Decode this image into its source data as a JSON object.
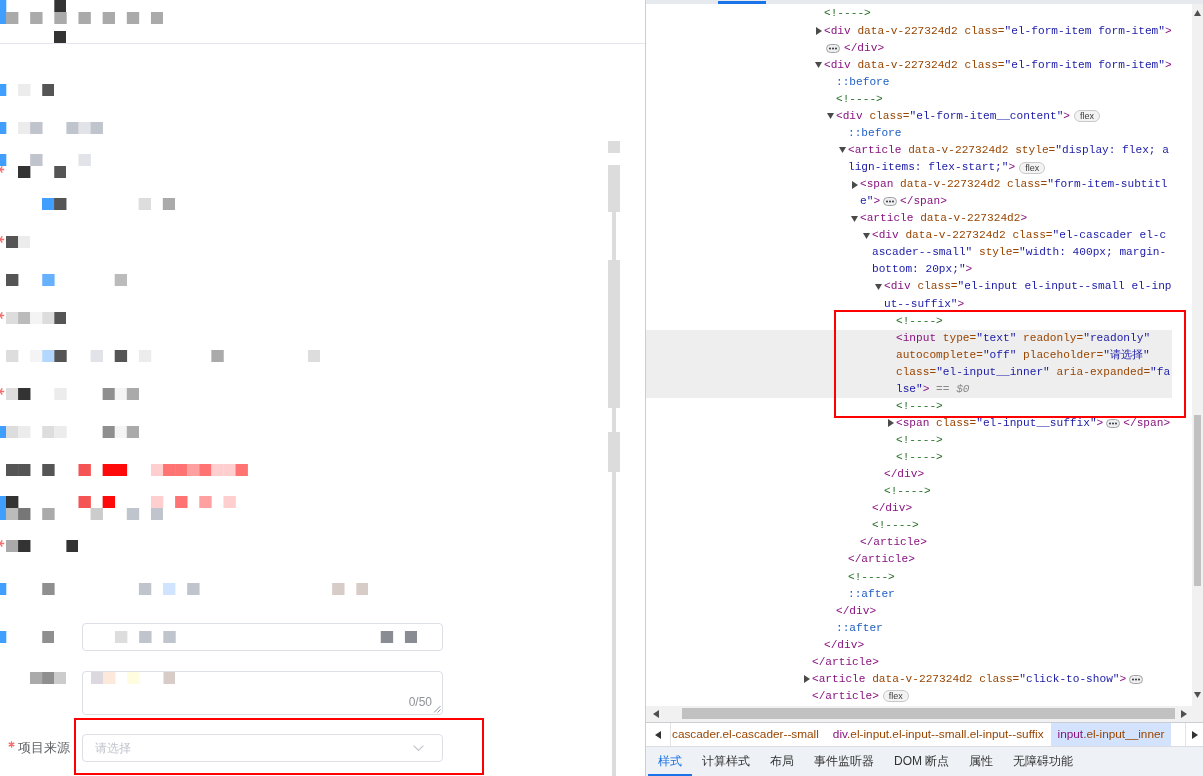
{
  "page": {
    "masked_rows": [
      {
        "kind": "text",
        "required": false
      },
      {
        "kind": "text",
        "required": false
      },
      {
        "kind": "text",
        "required": true
      },
      {
        "kind": "text",
        "required": false
      },
      {
        "kind": "text",
        "required": true
      },
      {
        "kind": "text",
        "required": false
      },
      {
        "kind": "text",
        "required": true
      },
      {
        "kind": "text",
        "required": false
      },
      {
        "kind": "text",
        "required": true
      },
      {
        "kind": "text",
        "required": false
      },
      {
        "kind": "text",
        "required": false
      },
      {
        "kind": "text",
        "required": false
      },
      {
        "kind": "text",
        "required": true
      },
      {
        "kind": "text",
        "required": false
      },
      {
        "kind": "input",
        "required": false
      },
      {
        "kind": "textarea",
        "required": false,
        "counter": "0/50"
      }
    ],
    "select_field": {
      "label": "项目来源",
      "required": true,
      "placeholder": "请选择",
      "boxed": true
    }
  },
  "devtools": {
    "elements_tree": [
      {
        "selected": false,
        "children": [
          {
            "selected": false,
            "lines": [
              [
                {
                  "kind": "comment",
                  "text": "<!---->"
                }
              ]
            ]
          },
          {
            "expanded": false,
            "selected": false,
            "lines": [
              [
                {
                  "kind": "tag",
                  "text": "<div"
                },
                {
                  "kind": "attr",
                  "text": " data-v-227324d2"
                },
                {
                  "kind": "attr",
                  "text": " class="
                },
                {
                  "kind": "value",
                  "text": "\"el-form-item form-item\""
                },
                {
                  "kind": "tag",
                  "text": ">"
                }
              ],
              [
                {
                  "kind": "ellipsis"
                },
                {
                  "kind": "tag",
                  "text": "</div>"
                }
              ]
            ]
          },
          {
            "expanded": true,
            "selected": false,
            "lines": [
              [
                {
                  "kind": "tag",
                  "text": "<div"
                },
                {
                  "kind": "attr",
                  "text": " data-v-227324d2"
                },
                {
                  "kind": "attr",
                  "text": " class="
                },
                {
                  "kind": "value",
                  "text": "\"el-form-item form-item\""
                },
                {
                  "kind": "tag",
                  "text": ">"
                }
              ]
            ],
            "children": [
              {
                "selected": false,
                "lines": [
                  [
                    {
                      "kind": "pseudo",
                      "text": "::before"
                    }
                  ]
                ]
              },
              {
                "selected": false,
                "lines": [
                  [
                    {
                      "kind": "comment",
                      "text": "<!---->"
                    }
                  ]
                ]
              },
              {
                "expanded": true,
                "selected": false,
                "lines": [
                  [
                    {
                      "kind": "tag",
                      "text": "<div"
                    },
                    {
                      "kind": "attr",
                      "text": " class="
                    },
                    {
                      "kind": "value",
                      "text": "\"el-form-item__content\""
                    },
                    {
                      "kind": "tag",
                      "text": ">"
                    },
                    {
                      "kind": "badge",
                      "text": "flex"
                    }
                  ]
                ],
                "children": [
                  {
                    "selected": false,
                    "lines": [
                      [
                        {
                          "kind": "pseudo",
                          "text": "::before"
                        }
                      ]
                    ]
                  },
                  {
                    "expanded": true,
                    "selected": false,
                    "lines": [
                      [
                        {
                          "kind": "tag",
                          "text": "<article"
                        },
                        {
                          "kind": "attr",
                          "text": " data-v-227324d2"
                        },
                        {
                          "kind": "attr",
                          "text": " style="
                        },
                        {
                          "kind": "value",
                          "text": "\"display: flex; a"
                        }
                      ],
                      [
                        {
                          "kind": "value",
                          "text": "lign-items: flex-start;\""
                        },
                        {
                          "kind": "tag",
                          "text": ">"
                        },
                        {
                          "kind": "badge",
                          "text": "flex"
                        }
                      ]
                    ],
                    "children": [
                      {
                        "expanded": false,
                        "selected": false,
                        "lines": [
                          [
                            {
                              "kind": "tag",
                              "text": "<span"
                            },
                            {
                              "kind": "attr",
                              "text": " data-v-227324d2"
                            },
                            {
                              "kind": "attr",
                              "text": " class="
                            },
                            {
                              "kind": "value",
                              "text": "\"form-item-subtitl"
                            }
                          ],
                          [
                            {
                              "kind": "value",
                              "text": "e\""
                            },
                            {
                              "kind": "tag",
                              "text": ">"
                            },
                            {
                              "kind": "ellipsis"
                            },
                            {
                              "kind": "tag",
                              "text": "</span>"
                            }
                          ]
                        ]
                      },
                      {
                        "expanded": true,
                        "selected": false,
                        "lines": [
                          [
                            {
                              "kind": "tag",
                              "text": "<article"
                            },
                            {
                              "kind": "attr",
                              "text": " data-v-227324d2"
                            },
                            {
                              "kind": "tag",
                              "text": ">"
                            }
                          ]
                        ],
                        "children": [
                          {
                            "expanded": true,
                            "selected": false,
                            "lines": [
                              [
                                {
                                  "kind": "tag",
                                  "text": "<div"
                                },
                                {
                                  "kind": "attr",
                                  "text": " data-v-227324d2"
                                },
                                {
                                  "kind": "attr",
                                  "text": " class="
                                },
                                {
                                  "kind": "value",
                                  "text": "\"el-cascader el-c"
                                }
                              ],
                              [
                                {
                                  "kind": "value",
                                  "text": "ascader--small\""
                                },
                                {
                                  "kind": "attr",
                                  "text": " style="
                                },
                                {
                                  "kind": "value",
                                  "text": "\"width: 400px; margin-"
                                }
                              ],
                              [
                                {
                                  "kind": "value",
                                  "text": "bottom: 20px;\""
                                },
                                {
                                  "kind": "tag",
                                  "text": ">"
                                }
                              ]
                            ],
                            "children": [
                              {
                                "expanded": true,
                                "selected": false,
                                "lines": [
                                  [
                                    {
                                      "kind": "tag",
                                      "text": "<div"
                                    },
                                    {
                                      "kind": "attr",
                                      "text": " class="
                                    },
                                    {
                                      "kind": "value",
                                      "text": "\"el-input el-input--small el-inp"
                                    }
                                  ],
                                  [
                                    {
                                      "kind": "value",
                                      "text": "ut--suffix\""
                                    },
                                    {
                                      "kind": "tag",
                                      "text": ">"
                                    }
                                  ]
                                ],
                                "children": [
                                  {
                                    "selected": false,
                                    "boxed": true,
                                    "lines": [
                                      [
                                        {
                                          "kind": "comment",
                                          "text": "<!---->"
                                        }
                                      ]
                                    ]
                                  },
                                  {
                                    "selected": true,
                                    "boxed": true,
                                    "lines": [
                                      [
                                        {
                                          "kind": "tag",
                                          "text": "<input"
                                        },
                                        {
                                          "kind": "attr",
                                          "text": " type="
                                        },
                                        {
                                          "kind": "value",
                                          "text": "\"text\""
                                        },
                                        {
                                          "kind": "attr",
                                          "text": " readonly="
                                        },
                                        {
                                          "kind": "value",
                                          "text": "\"readonly\""
                                        }
                                      ],
                                      [
                                        {
                                          "kind": "attr",
                                          "text": "autocomplete="
                                        },
                                        {
                                          "kind": "value",
                                          "text": "\"off\""
                                        },
                                        {
                                          "kind": "attr",
                                          "text": " placeholder="
                                        },
                                        {
                                          "kind": "value",
                                          "text": "\"请选择\""
                                        }
                                      ],
                                      [
                                        {
                                          "kind": "attr",
                                          "text": "class="
                                        },
                                        {
                                          "kind": "value",
                                          "text": "\"el-input__inner\""
                                        },
                                        {
                                          "kind": "attr",
                                          "text": " aria-expanded="
                                        },
                                        {
                                          "kind": "value",
                                          "text": "\"fa"
                                        }
                                      ],
                                      [
                                        {
                                          "kind": "value",
                                          "text": "lse\""
                                        },
                                        {
                                          "kind": "tag",
                                          "text": ">"
                                        },
                                        {
                                          "kind": "note",
                                          "text": " == $0"
                                        }
                                      ]
                                    ]
                                  },
                                  {
                                    "selected": false,
                                    "boxed": true,
                                    "lines": [
                                      [
                                        {
                                          "kind": "comment",
                                          "text": "<!---->"
                                        }
                                      ]
                                    ]
                                  },
                                  {
                                    "expanded": false,
                                    "selected": false,
                                    "boxed": false,
                                    "lines": [
                                      [
                                        {
                                          "kind": "tag",
                                          "text": "<span"
                                        },
                                        {
                                          "kind": "attr",
                                          "text": " class="
                                        },
                                        {
                                          "kind": "value",
                                          "text": "\"el-input__suffix\""
                                        },
                                        {
                                          "kind": "tag",
                                          "text": ">"
                                        },
                                        {
                                          "kind": "ellipsis"
                                        },
                                        {
                                          "kind": "tag",
                                          "text": "</span>"
                                        }
                                      ]
                                    ]
                                  },
                                  {
                                    "selected": false,
                                    "boxed": false,
                                    "lines": [
                                      [
                                        {
                                          "kind": "comment",
                                          "text": "<!---->"
                                        }
                                      ]
                                    ]
                                  },
                                  {
                                    "selected": false,
                                    "boxed": false,
                                    "lines": [
                                      [
                                        {
                                          "kind": "comment",
                                          "text": "<!---->"
                                        }
                                      ]
                                    ]
                                  }
                                ],
                                "closing": [
                                  [
                                    {
                                      "kind": "tag",
                                      "text": "</div>"
                                    }
                                  ]
                                ]
                              },
                              {
                                "selected": false,
                                "lines": [
                                  [
                                    {
                                      "kind": "comment",
                                      "text": "<!---->"
                                    }
                                  ]
                                ]
                              }
                            ],
                            "closing": [
                              [
                                {
                                  "kind": "tag",
                                  "text": "</div>"
                                }
                              ]
                            ]
                          },
                          {
                            "selected": false,
                            "lines": [
                              [
                                {
                                  "kind": "comment",
                                  "text": "<!---->"
                                }
                              ]
                            ]
                          }
                        ],
                        "closing": [
                          [
                            {
                              "kind": "tag",
                              "text": "</article>"
                            }
                          ]
                        ]
                      }
                    ],
                    "closing": [
                      [
                        {
                          "kind": "tag",
                          "text": "</article>"
                        }
                      ]
                    ]
                  },
                  {
                    "selected": false,
                    "lines": [
                      [
                        {
                          "kind": "comment",
                          "text": "<!---->"
                        }
                      ]
                    ]
                  },
                  {
                    "selected": false,
                    "lines": [
                      [
                        {
                          "kind": "pseudo",
                          "text": "::after"
                        }
                      ]
                    ]
                  }
                ],
                "closing": [
                  [
                    {
                      "kind": "tag",
                      "text": "</div>"
                    }
                  ]
                ]
              },
              {
                "selected": false,
                "lines": [
                  [
                    {
                      "kind": "pseudo",
                      "text": "::after"
                    }
                  ]
                ]
              }
            ],
            "closing": [
              [
                {
                  "kind": "tag",
                  "text": "</div>"
                }
              ]
            ]
          }
        ],
        "closing": [
          [
            {
              "kind": "tag",
              "text": "</article>"
            }
          ]
        ]
      },
      {
        "expanded": false,
        "selected": false,
        "lines": [
          [
            {
              "kind": "tag",
              "text": "<article"
            },
            {
              "kind": "attr",
              "text": " data-v-227324d2"
            },
            {
              "kind": "attr",
              "text": " class="
            },
            {
              "kind": "value",
              "text": "\"click-to-show\""
            },
            {
              "kind": "tag",
              "text": ">"
            },
            {
              "kind": "ellipsis"
            }
          ],
          [
            {
              "kind": "tag",
              "text": "</article>"
            },
            {
              "kind": "badge",
              "text": "flex"
            }
          ]
        ]
      }
    ],
    "breadcrumbs": [
      {
        "classes": "cascader.el-cascader--small",
        "selected": false
      },
      {
        "tag": "div",
        "classes": ".el-input.el-input--small.el-input--suffix",
        "selected": false
      },
      {
        "tag": "input",
        "classes": ".el-input__inner",
        "selected": true
      }
    ],
    "tabs": [
      {
        "label": "样式",
        "selected": true
      },
      {
        "label": "计算样式",
        "selected": false
      },
      {
        "label": "布局",
        "selected": false
      },
      {
        "label": "事件监听器",
        "selected": false
      },
      {
        "label": "DOM 断点",
        "selected": false
      },
      {
        "label": "属性",
        "selected": false
      },
      {
        "label": "无障碍功能",
        "selected": false
      }
    ]
  }
}
